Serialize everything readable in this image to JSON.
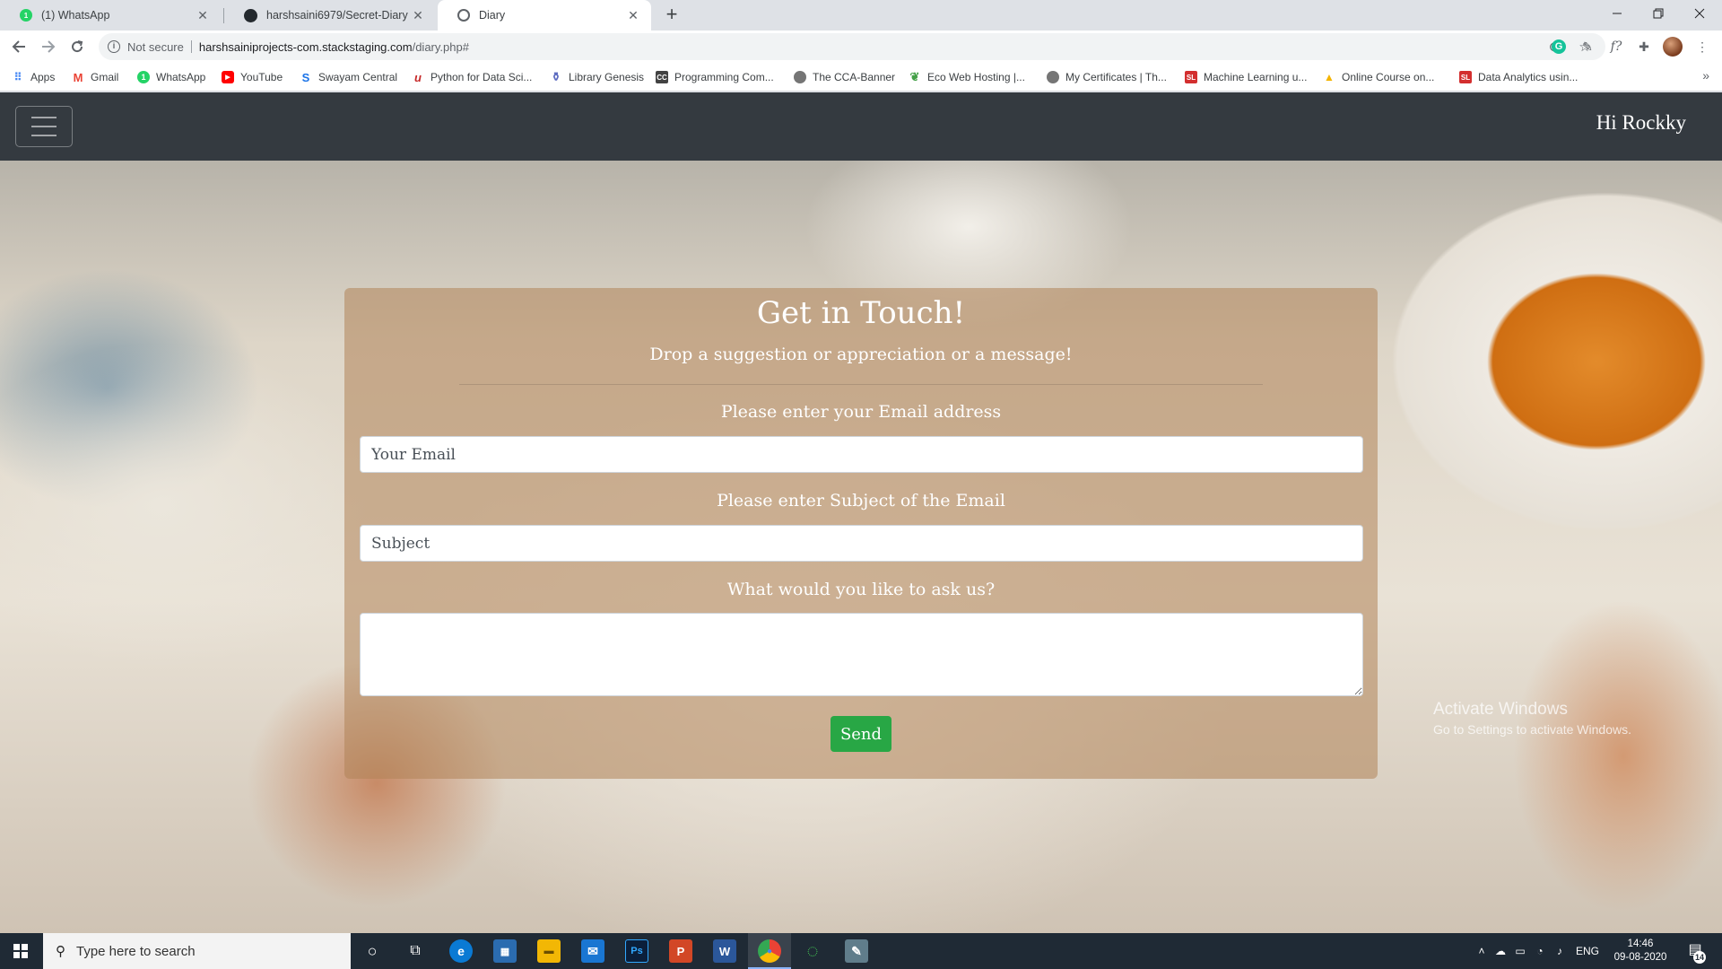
{
  "browser": {
    "tabs": [
      {
        "title": "(1) WhatsApp",
        "icon": "whatsapp-icon",
        "active": false
      },
      {
        "title": "harshsaini6979/Secret-Diary",
        "icon": "github-icon",
        "active": false
      },
      {
        "title": "Diary",
        "icon": "globe-icon",
        "active": true
      }
    ],
    "new_tab": "+",
    "close_glyph": "✕",
    "url": {
      "security_label": "Not secure",
      "host": "harshsainiprojects-com.stackstaging.com",
      "path": "/diary.php#"
    },
    "bookmarks": [
      {
        "label": "Apps",
        "color": "#4285f4",
        "glyph": "⋮⋮"
      },
      {
        "label": "Gmail",
        "color": "#ea4335",
        "glyph": "M"
      },
      {
        "label": "WhatsApp",
        "color": "#25d366",
        "glyph": "W"
      },
      {
        "label": "YouTube",
        "color": "#ff0000",
        "glyph": "▶"
      },
      {
        "label": "Swayam Central",
        "color": "#1a73e8",
        "glyph": "S"
      },
      {
        "label": "Python for Data Sci...",
        "color": "#c62828",
        "glyph": "u"
      },
      {
        "label": "Library Genesis",
        "color": "#5c6bc0",
        "glyph": "L"
      },
      {
        "label": "Programming Com...",
        "color": "#424242",
        "glyph": "C"
      },
      {
        "label": "The CCA-Banner",
        "color": "#757575",
        "glyph": "◎"
      },
      {
        "label": "Eco Web Hosting |...",
        "color": "#43a047",
        "glyph": "e"
      },
      {
        "label": "My Certificates | Th...",
        "color": "#757575",
        "glyph": "◎"
      },
      {
        "label": "Machine Learning u...",
        "color": "#d32f2f",
        "glyph": "SL"
      },
      {
        "label": "Online Course on...",
        "color": "#f4b400",
        "glyph": "▲"
      },
      {
        "label": "Data Analytics usin...",
        "color": "#d32f2f",
        "glyph": "SL"
      }
    ],
    "bookmarks_overflow": "»"
  },
  "page": {
    "navbar": {
      "greeting": "Hi Rockky"
    },
    "contact": {
      "title": "Get in Touch!",
      "subtitle": "Drop a suggestion or appreciation or a message!",
      "email_label": "Please enter your Email address",
      "email_placeholder": "Your Email",
      "email_value": "",
      "subject_label": "Please enter Subject of the Email",
      "subject_placeholder": "Subject",
      "subject_value": "",
      "message_label": "What would you like to ask us?",
      "message_value": "",
      "send_label": "Send"
    },
    "watermark": {
      "title": "Activate Windows",
      "subtitle": "Go to Settings to activate Windows."
    }
  },
  "taskbar": {
    "search_placeholder": "Type here to search",
    "apps": [
      {
        "name": "cortana-icon",
        "glyph": "○"
      },
      {
        "name": "task-view-icon",
        "glyph": "⧉"
      },
      {
        "name": "edge-icon",
        "glyph": "e",
        "color": "#0a7ad4"
      },
      {
        "name": "store-icon",
        "glyph": "▦",
        "color": "#2b6cb0"
      },
      {
        "name": "file-explorer-icon",
        "glyph": "▬",
        "color": "#f2b705"
      },
      {
        "name": "mail-icon",
        "glyph": "✉",
        "color": "#1976d2"
      },
      {
        "name": "photoshop-icon",
        "glyph": "Ps",
        "color": "#0b1f3a"
      },
      {
        "name": "powerpoint-icon",
        "glyph": "P",
        "color": "#d24726"
      },
      {
        "name": "word-icon",
        "glyph": "W",
        "color": "#2b579a"
      },
      {
        "name": "chrome-icon",
        "glyph": "●",
        "color": "#4285f4"
      },
      {
        "name": "spinner-app-icon",
        "glyph": "◌",
        "color": "#2e7d32"
      },
      {
        "name": "paint-app-icon",
        "glyph": "✎",
        "color": "#607d8b"
      }
    ],
    "language": "ENG",
    "time": "14:46",
    "date": "09-08-2020",
    "notification_count": "14"
  }
}
